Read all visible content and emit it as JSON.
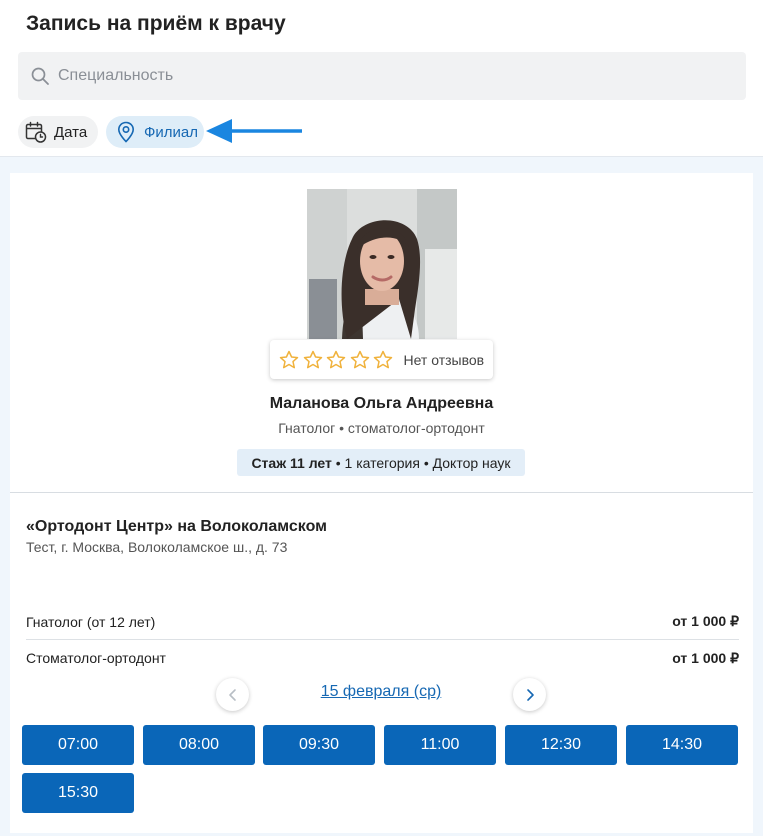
{
  "header": {
    "title": "Запись на приём к врачу",
    "search": {
      "placeholder": "Специальность",
      "value": ""
    },
    "filters": [
      {
        "label": "Дата",
        "icon": "calendar-clock-icon"
      },
      {
        "label": "Филиал",
        "icon": "location-pin-icon",
        "active": true
      }
    ]
  },
  "doctor": {
    "rating_text": "Нет отзывов",
    "stars_filled": 0,
    "stars_total": 5,
    "name": "Маланова Ольга Андреевна",
    "specialties": "Гнатолог • стоматолог-ортодонт",
    "experience": "Стаж 11 лет",
    "details": " • 1 категория • Доктор наук"
  },
  "clinic": {
    "name": "«Ортодонт Центр» на Волоколамском",
    "address": "Тест, г. Москва, Волоколамское ш., д. 73"
  },
  "services": [
    {
      "name": "Гнатолог (от 12 лет)",
      "price": "от 1 000 ₽"
    },
    {
      "name": "Стоматолог-ортодонт",
      "price": "от 1 000 ₽"
    }
  ],
  "schedule": {
    "date": "15 февраля (ср)",
    "slots": [
      "07:00",
      "08:00",
      "09:30",
      "11:00",
      "12:30",
      "14:30",
      "15:30"
    ]
  },
  "colors": {
    "accent": "#0a66b8",
    "link": "#1668b3",
    "star": "#f0b23c",
    "arrow": "#1a86e0"
  }
}
